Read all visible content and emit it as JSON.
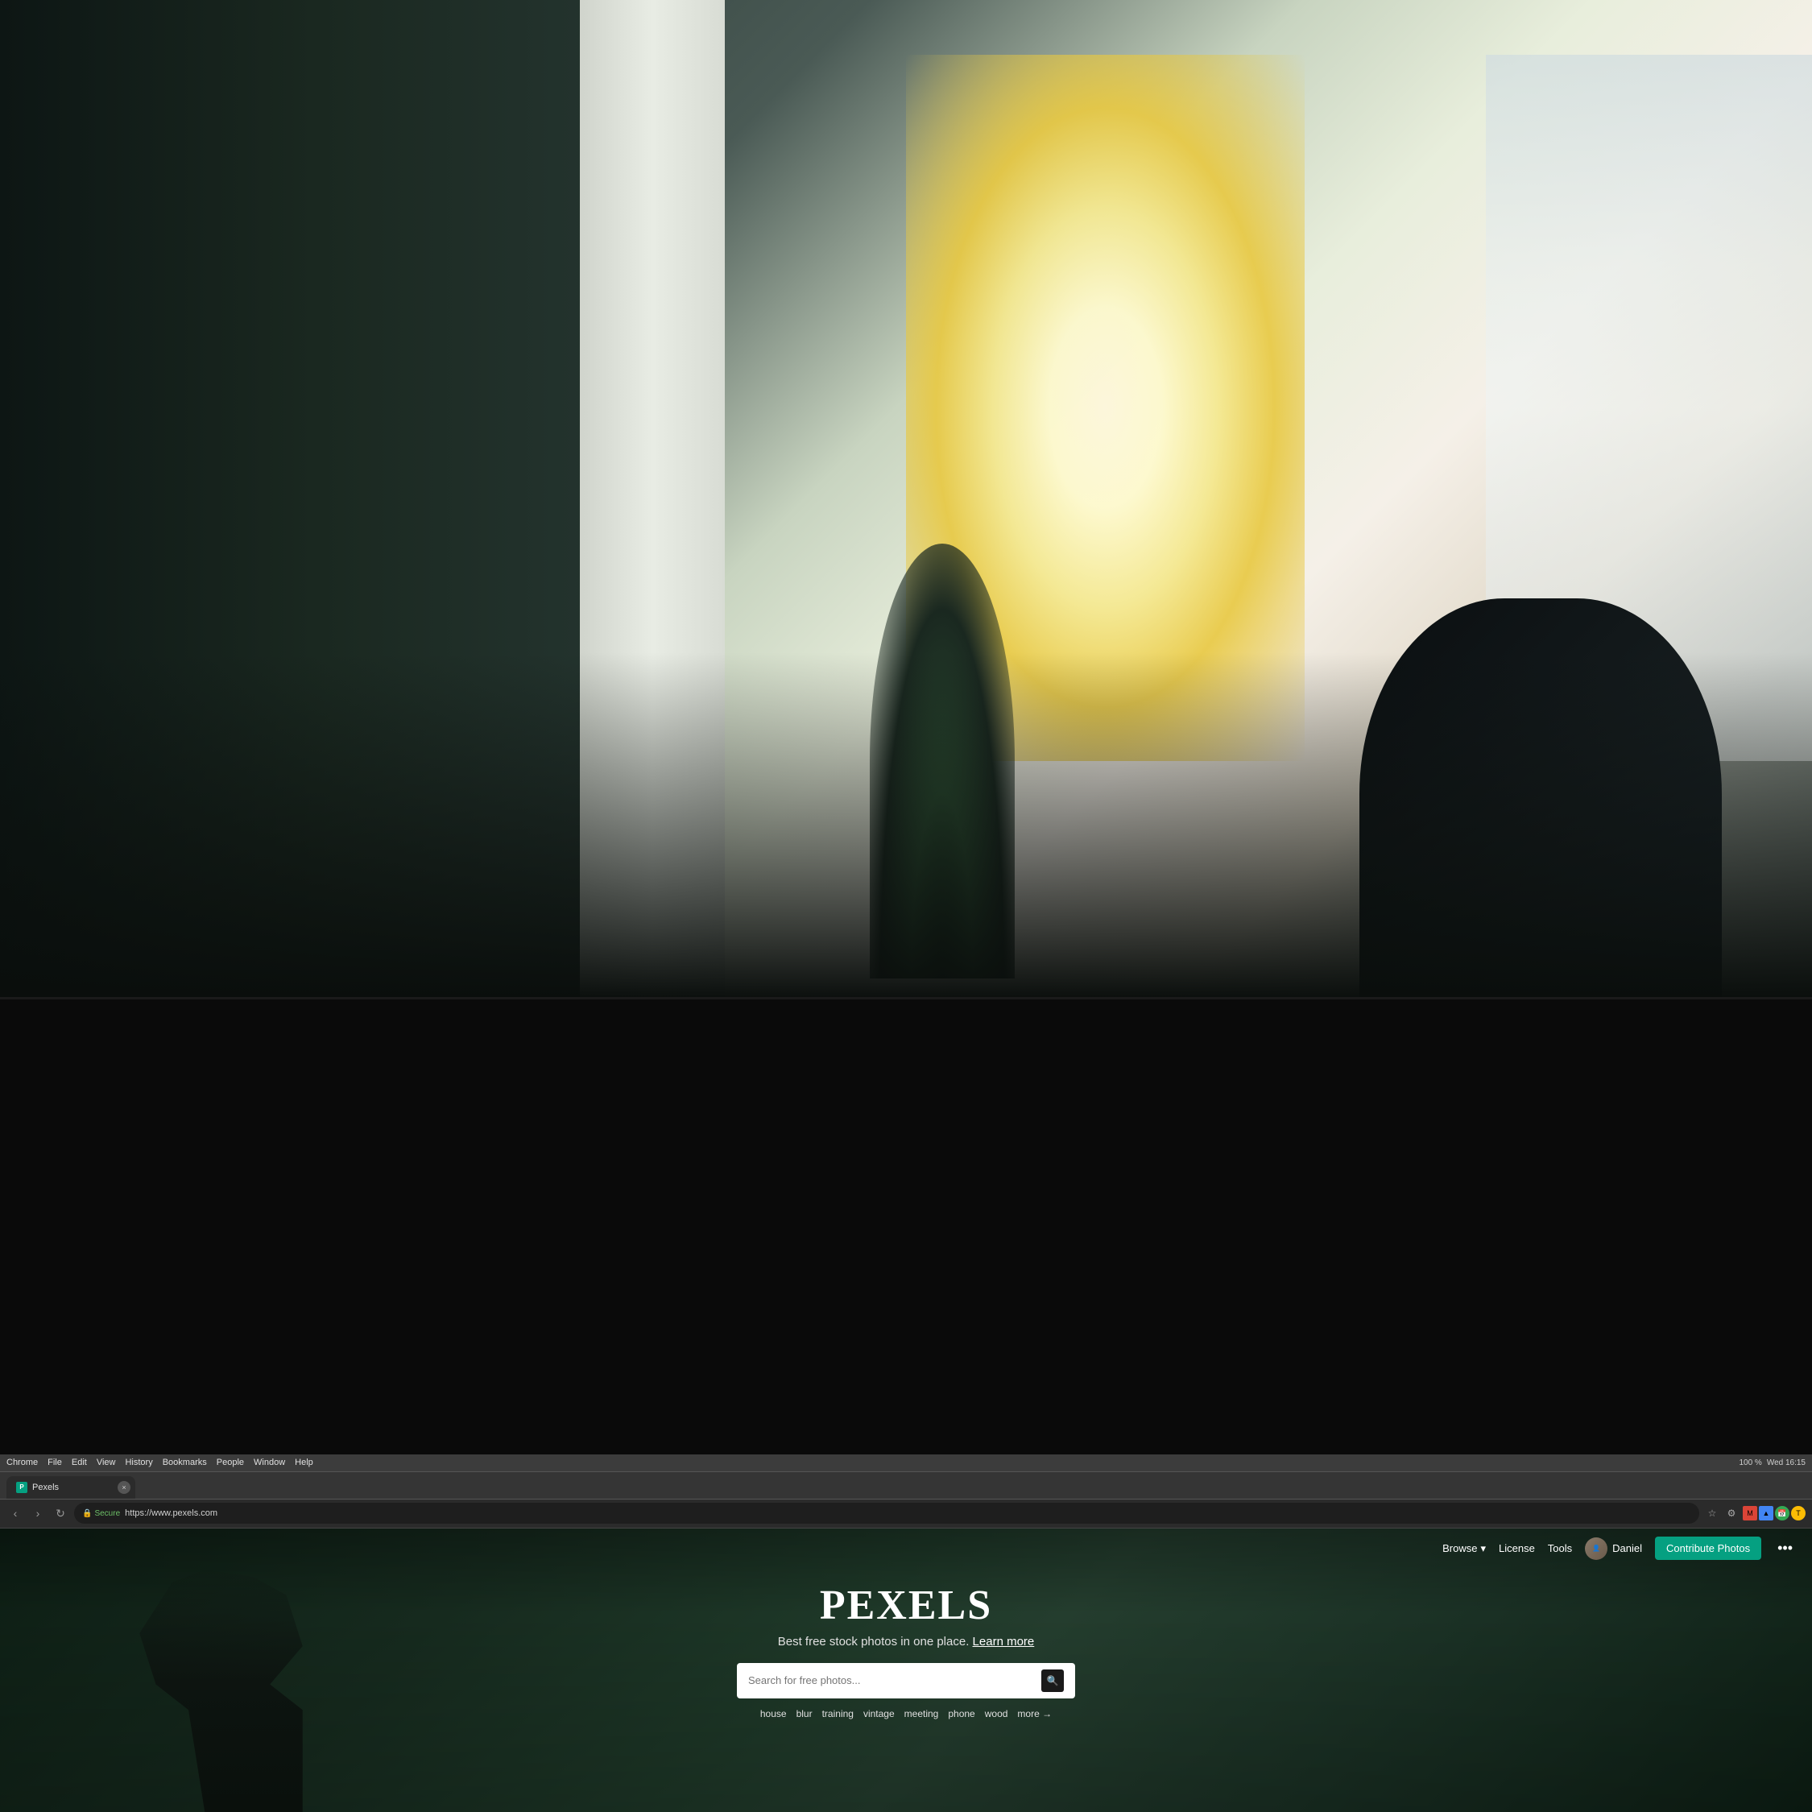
{
  "background": {
    "scene": "office-interior"
  },
  "os": {
    "menubar": {
      "app": "Chrome",
      "menus": [
        "File",
        "Edit",
        "View",
        "History",
        "Bookmarks",
        "People",
        "Window",
        "Help"
      ],
      "time": "Wed 16:15",
      "battery": "100 %"
    }
  },
  "browser": {
    "tab": {
      "title": "Pexels",
      "favicon_text": "P"
    },
    "address": {
      "secure_label": "Secure",
      "url": "https://www.pexels.com"
    },
    "close_label": "×"
  },
  "pexels": {
    "nav": {
      "browse_label": "Browse",
      "license_label": "License",
      "tools_label": "Tools",
      "username": "Daniel",
      "contribute_label": "Contribute Photos",
      "more_label": "•••"
    },
    "hero": {
      "logo": "PEXELS",
      "tagline": "Best free stock photos in one place.",
      "learn_more": "Learn more"
    },
    "search": {
      "placeholder": "Search for free photos..."
    },
    "tags": [
      {
        "label": "house"
      },
      {
        "label": "blur"
      },
      {
        "label": "training"
      },
      {
        "label": "vintage"
      },
      {
        "label": "meeting"
      },
      {
        "label": "phone"
      },
      {
        "label": "wood"
      },
      {
        "label": "more →"
      }
    ]
  }
}
